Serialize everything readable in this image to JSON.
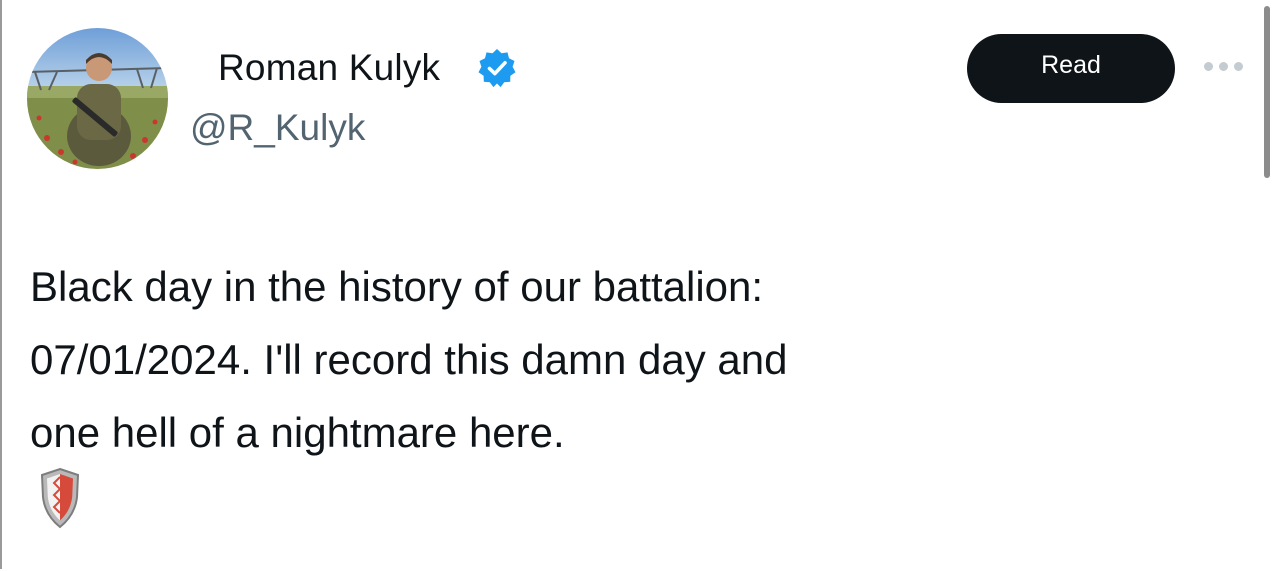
{
  "author": {
    "display_name": "Roman Kulyk",
    "handle": "@R_Kulyk",
    "verified_icon": "verified-badge-icon",
    "verified_color": "#1d9bf0"
  },
  "actions": {
    "read_label": "Read",
    "more_icon": "more-horizontal-icon"
  },
  "tweet": {
    "lines": [
      "Black day in the history of our battalion:",
      "07/01/2024. I'll record this damn day and",
      "one hell of a nightmare here."
    ],
    "emoji_icon": "shield-icon"
  },
  "colors": {
    "text": "#0f1419",
    "secondary": "#536471",
    "button_bg": "#0f1419",
    "button_text": "#ffffff"
  }
}
